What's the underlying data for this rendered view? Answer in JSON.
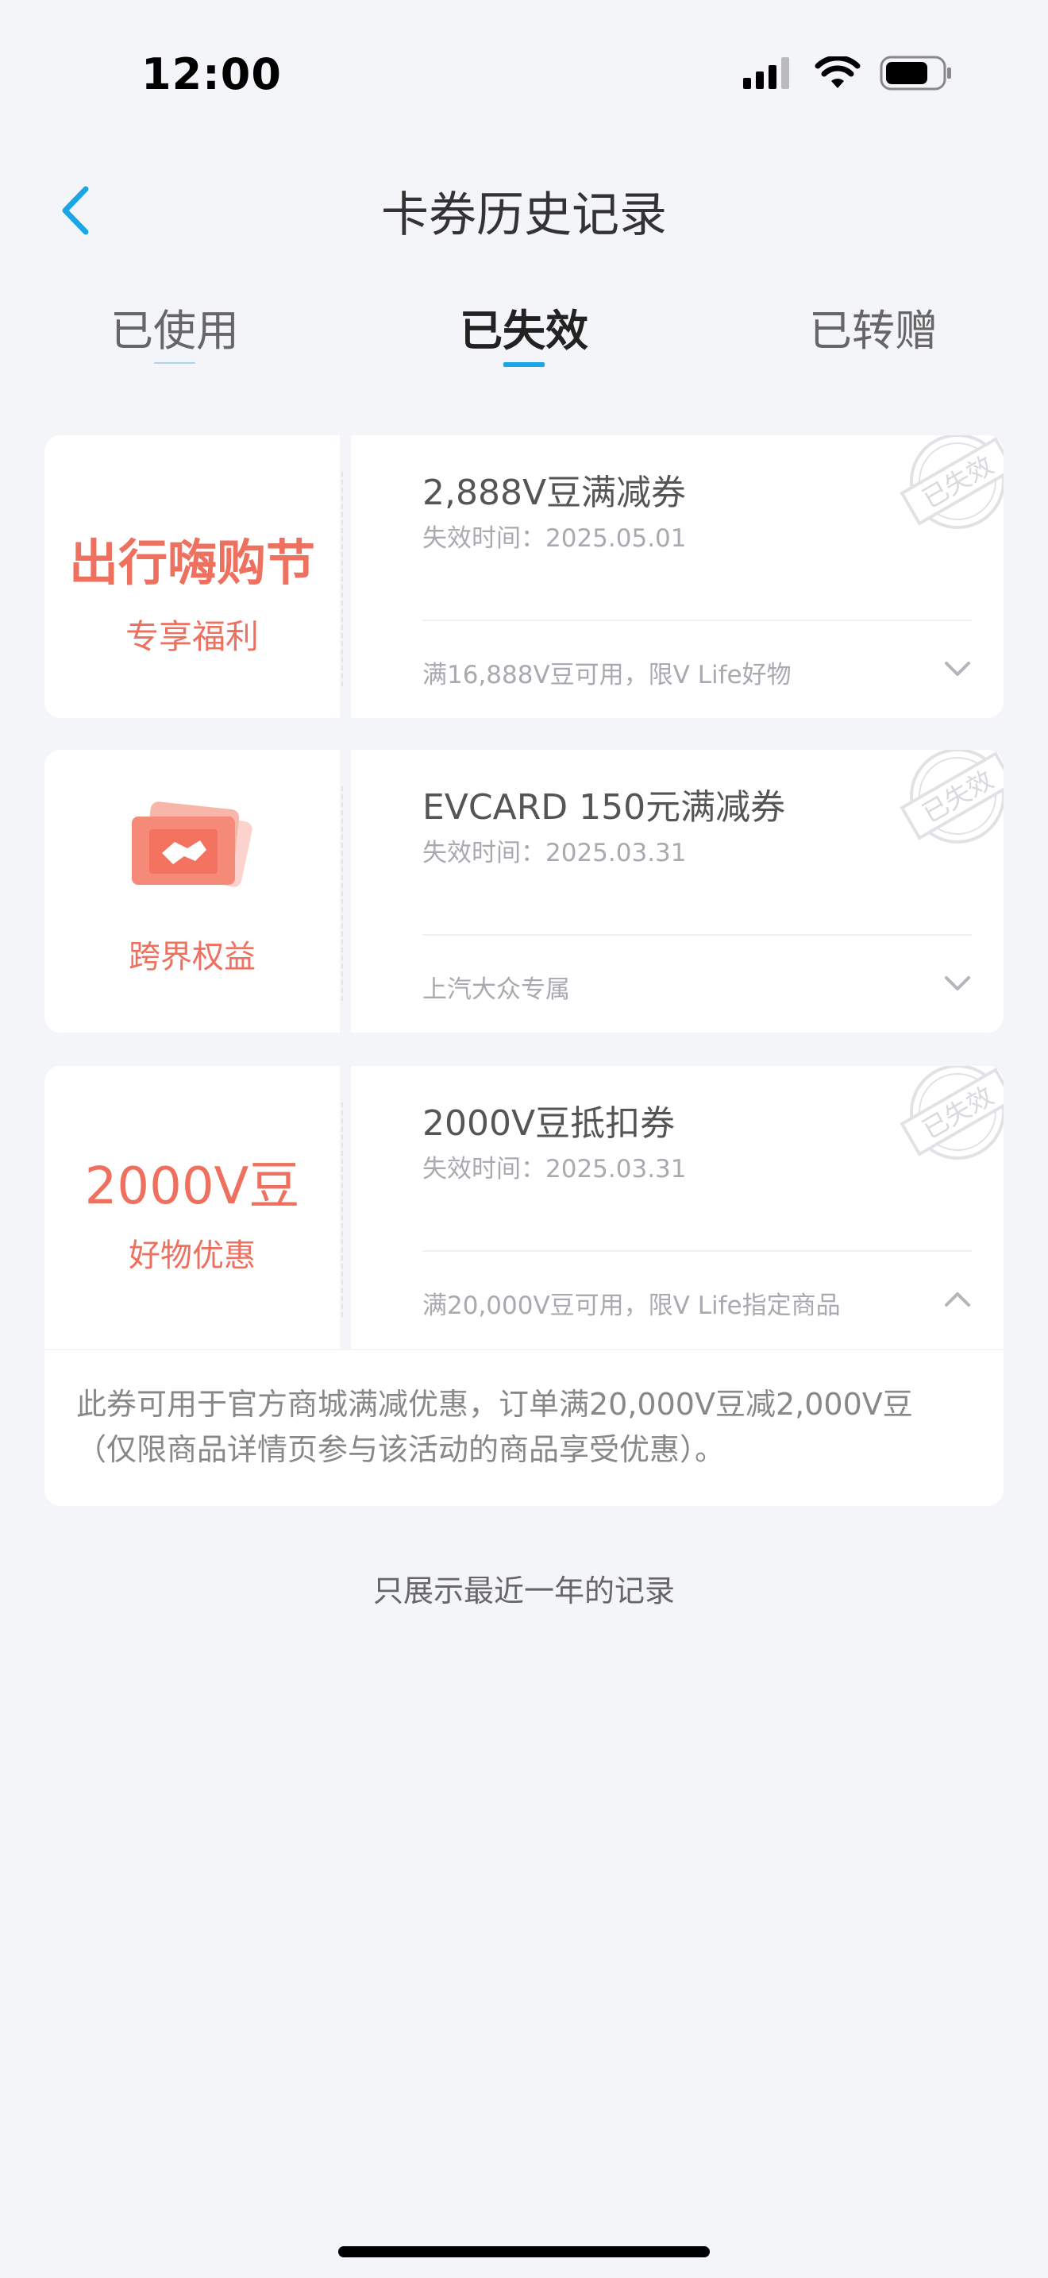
{
  "status_bar": {
    "time": "12:00"
  },
  "header": {
    "title": "卡券历史记录"
  },
  "tabs": [
    {
      "label": "已使用",
      "active": false
    },
    {
      "label": "已失效",
      "active": true
    },
    {
      "label": "已转赠",
      "active": false
    }
  ],
  "coupons": [
    {
      "left_title": "出行嗨购节",
      "left_sub": "专享福利",
      "title": "2,888V豆满减券",
      "expire": "失效时间：2025.05.01",
      "note": "满16,888V豆可用，限V Life好物",
      "stamp": "已失效",
      "expanded": false
    },
    {
      "left_title": "",
      "left_sub": "跨界权益",
      "title": "EVCARD 150元满减券",
      "expire": "失效时间：2025.03.31",
      "note": "上汽大众专属",
      "stamp": "已失效",
      "expanded": false
    },
    {
      "left_title": "2000V豆",
      "left_sub": "好物优惠",
      "title": "2000V豆抵扣券",
      "expire": "失效时间：2025.03.31",
      "note": "满20,000V豆可用，限V Life指定商品",
      "stamp": "已失效",
      "expanded": true,
      "description": "此券可用于官方商城满减优惠，订单满20,000V豆减2,000V豆（仅限商品详情页参与该活动的商品享受优惠）。"
    }
  ],
  "footer_note": "只展示最近一年的记录",
  "colors": {
    "accent": "#1aa6e4",
    "coupon_red": "#ee7160",
    "background": "#f4f5f8"
  }
}
